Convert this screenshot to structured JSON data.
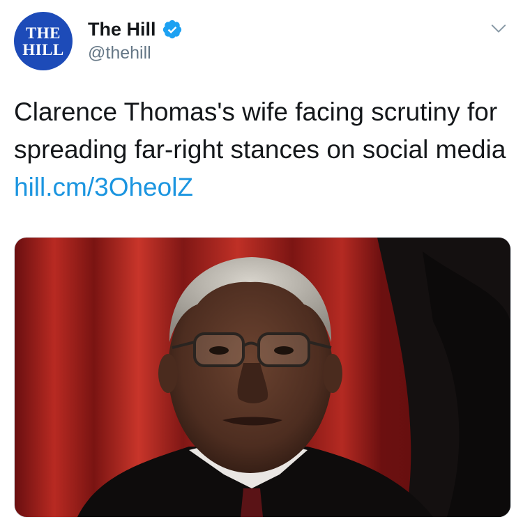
{
  "tweet": {
    "author": {
      "display_name": "The Hill",
      "handle": "@thehill",
      "avatar_line1": "THE",
      "avatar_line2": "HILL",
      "verified": true
    },
    "text": "Clarence Thomas's wife facing scrutiny for spreading far-right stances on social media",
    "link": "hill.cm/3OheolZ",
    "media": {
      "icon": "photo-image"
    }
  },
  "colors": {
    "avatar_bg": "#1d4bb8",
    "verified": "#1da1f2",
    "link": "#1b95e0",
    "handle": "#657786",
    "text": "#14171a"
  }
}
